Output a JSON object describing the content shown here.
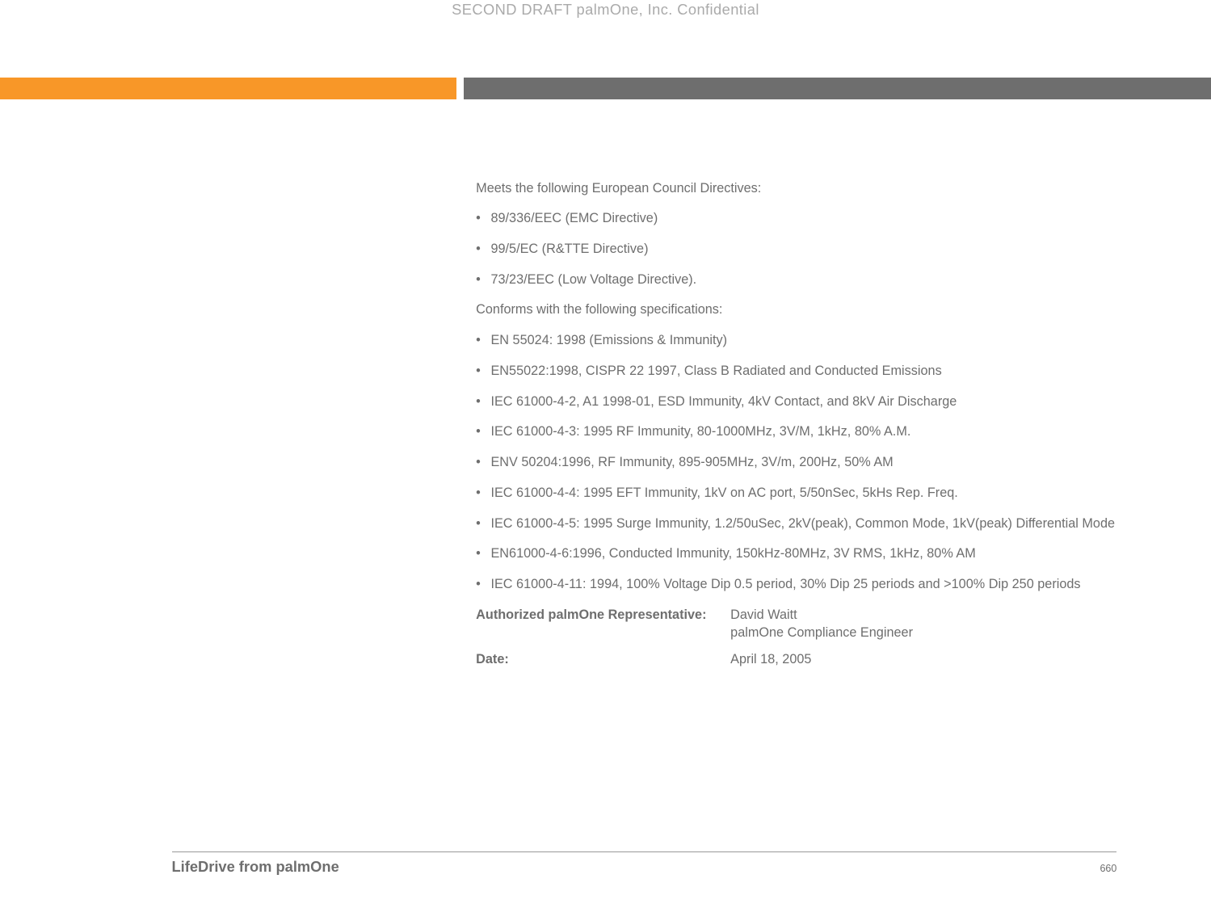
{
  "header_watermark": "SECOND DRAFT palmOne, Inc.  Confidential",
  "body": {
    "intro1": "Meets the following European Council Directives:",
    "directives": [
      "89/336/EEC (EMC Directive)",
      "99/5/EC (R&TTE Directive)",
      "73/23/EEC (Low Voltage Directive)."
    ],
    "intro2": "Conforms with the following specifications:",
    "specs": [
      "EN 55024: 1998 (Emissions & Immunity)",
      "EN55022:1998, CISPR 22 1997, Class B Radiated and Conducted Emissions",
      "IEC 61000-4-2, A1 1998-01, ESD Immunity, 4kV Contact, and 8kV Air Discharge",
      "IEC 61000-4-3: 1995 RF Immunity, 80-1000MHz, 3V/M, 1kHz, 80% A.M.",
      "ENV 50204:1996, RF Immunity, 895-905MHz, 3V/m, 200Hz, 50% AM",
      "IEC 61000-4-4: 1995 EFT Immunity, 1kV on AC port, 5/50nSec, 5kHs Rep. Freq.",
      "IEC 61000-4-5: 1995 Surge Immunity, 1.2/50uSec, 2kV(peak), Common Mode, 1kV(peak) Differential Mode",
      "EN61000-4-6:1996, Conducted Immunity, 150kHz-80MHz, 3V RMS, 1kHz, 80% AM",
      "IEC 61000-4-11: 1994, 100% Voltage Dip 0.5 period, 30% Dip 25 periods and >100% Dip 250 periods"
    ],
    "rep_label": "Authorized palmOne Representative:",
    "rep_name": "David Waitt",
    "rep_title": "palmOne Compliance Engineer",
    "date_label": "Date:",
    "date_value": "April 18, 2005"
  },
  "footer": {
    "title": "LifeDrive from palmOne",
    "page": "660"
  }
}
